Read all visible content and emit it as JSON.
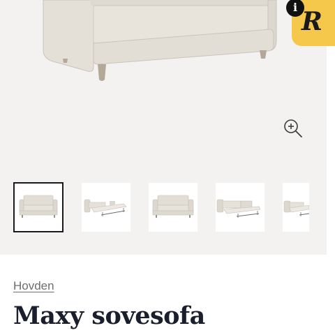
{
  "gallery": {
    "thumbnails": [
      {
        "name": "sofa-front",
        "selected": true
      },
      {
        "name": "sofa-bed-open",
        "selected": false
      },
      {
        "name": "sofa-front",
        "selected": false
      },
      {
        "name": "sofa-bed-open",
        "selected": false
      },
      {
        "name": "sofa-bed-open",
        "selected": false
      }
    ],
    "zoom_icon": "zoom-in-icon"
  },
  "badge": {
    "letter": "R",
    "info_glyph": "i",
    "color": "#f5c84c"
  },
  "product": {
    "brand": "Hovden",
    "title": "Maxy sovesofa"
  },
  "colors": {
    "gallery_bg": "#f3f2f0",
    "sofa_fabric": "#e6e2da",
    "title_text": "#1b1f2b"
  }
}
